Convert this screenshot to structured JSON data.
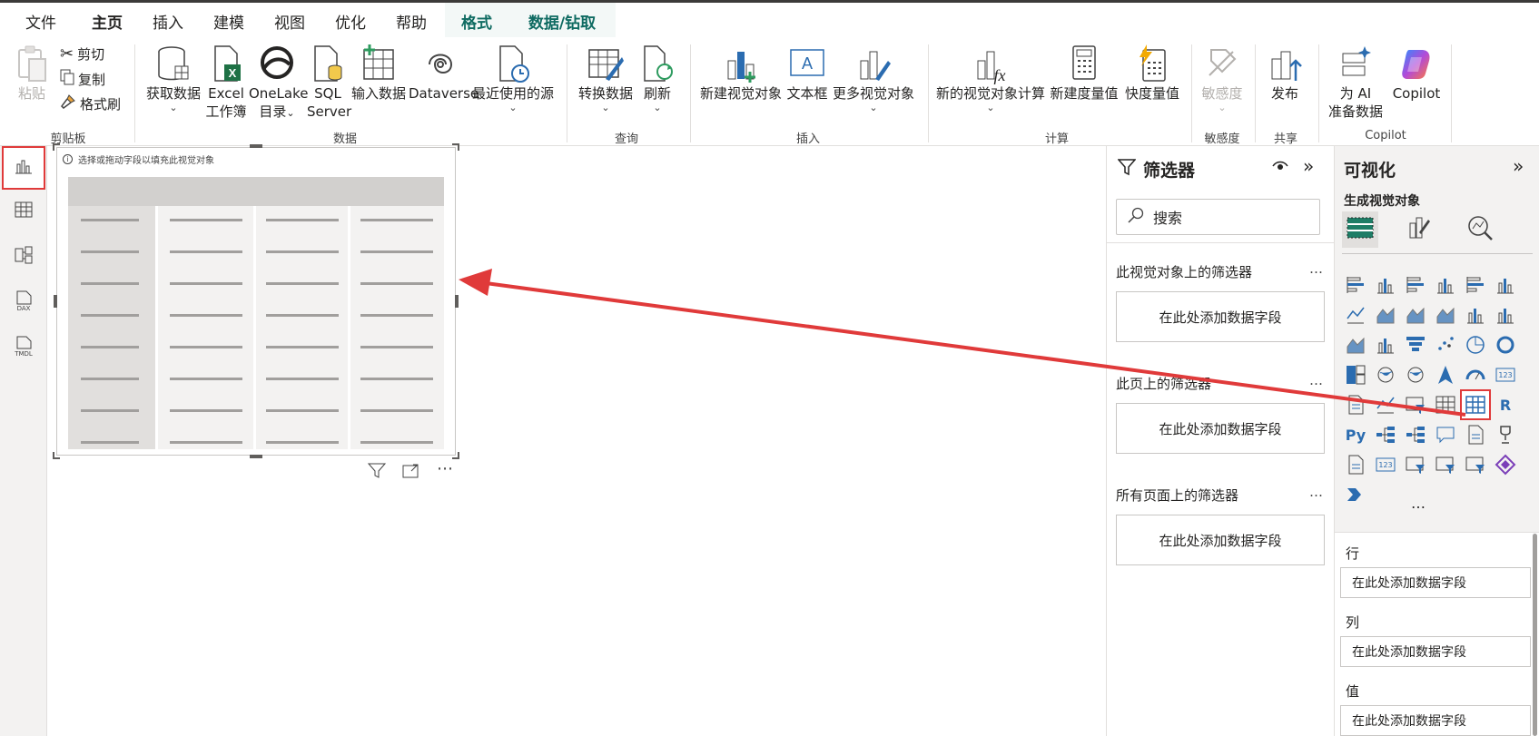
{
  "menu": {
    "tabs": [
      {
        "label": "文件"
      },
      {
        "label": "主页"
      },
      {
        "label": "插入"
      },
      {
        "label": "建模"
      },
      {
        "label": "视图"
      },
      {
        "label": "优化"
      },
      {
        "label": "帮助"
      },
      {
        "label": "格式"
      },
      {
        "label": "数据/钻取"
      }
    ]
  },
  "ribbon": {
    "clipboard": {
      "paste": "粘贴",
      "cut": "剪切",
      "copy": "复制",
      "format_painter": "格式刷",
      "group": "剪贴板"
    },
    "data": {
      "get_data": "获取数据",
      "excel_1": "Excel",
      "excel_2": "工作簿",
      "onelake_1": "OneLake",
      "onelake_2": "目录",
      "sql_1": "SQL",
      "sql_2": "Server",
      "enter_data": "输入数据",
      "dataverse": "Dataverse",
      "recent_sources": "最近使用的源",
      "group": "数据"
    },
    "queries": {
      "transform": "转换数据",
      "refresh": "刷新",
      "group": "查询"
    },
    "insert": {
      "new_visual": "新建视觉对象",
      "text_box": "文本框",
      "more_visuals": "更多视觉对象",
      "group": "插入"
    },
    "calculations": {
      "new_visual_calc": "新的视觉对象计算",
      "new_measure": "新建度量值",
      "quick_measure": "快度量值",
      "group": "计算"
    },
    "sensitivity": {
      "label": "敏感度",
      "group": "敏感度"
    },
    "share": {
      "publish": "发布",
      "group": "共享"
    },
    "copilot": {
      "ai_1": "为 AI",
      "ai_2": "准备数据",
      "copilot": "Copilot",
      "group": "Copilot"
    }
  },
  "canvas": {
    "hint": "选择或拖动字段以填充此视觉对象"
  },
  "filters": {
    "title": "筛选器",
    "search_placeholder": "搜索",
    "sections": [
      {
        "label": "此视觉对象上的筛选器",
        "drop": "在此处添加数据字段"
      },
      {
        "label": "此页上的筛选器",
        "drop": "在此处添加数据字段"
      },
      {
        "label": "所有页面上的筛选器",
        "drop": "在此处添加数据字段"
      }
    ],
    "more": "…"
  },
  "visualizations": {
    "title": "可视化",
    "subtitle": "生成视觉对象",
    "more": "…",
    "wells": [
      {
        "label": "行",
        "drop": "在此处添加数据字段"
      },
      {
        "label": "列",
        "drop": "在此处添加数据字段"
      },
      {
        "label": "值",
        "drop": "在此处添加数据字段"
      }
    ]
  },
  "colors": {
    "accent_red": "#e03a3a",
    "teal": "#0f6b62",
    "excel_green": "#1e7145",
    "viz_blue": "#2b6cb0"
  }
}
